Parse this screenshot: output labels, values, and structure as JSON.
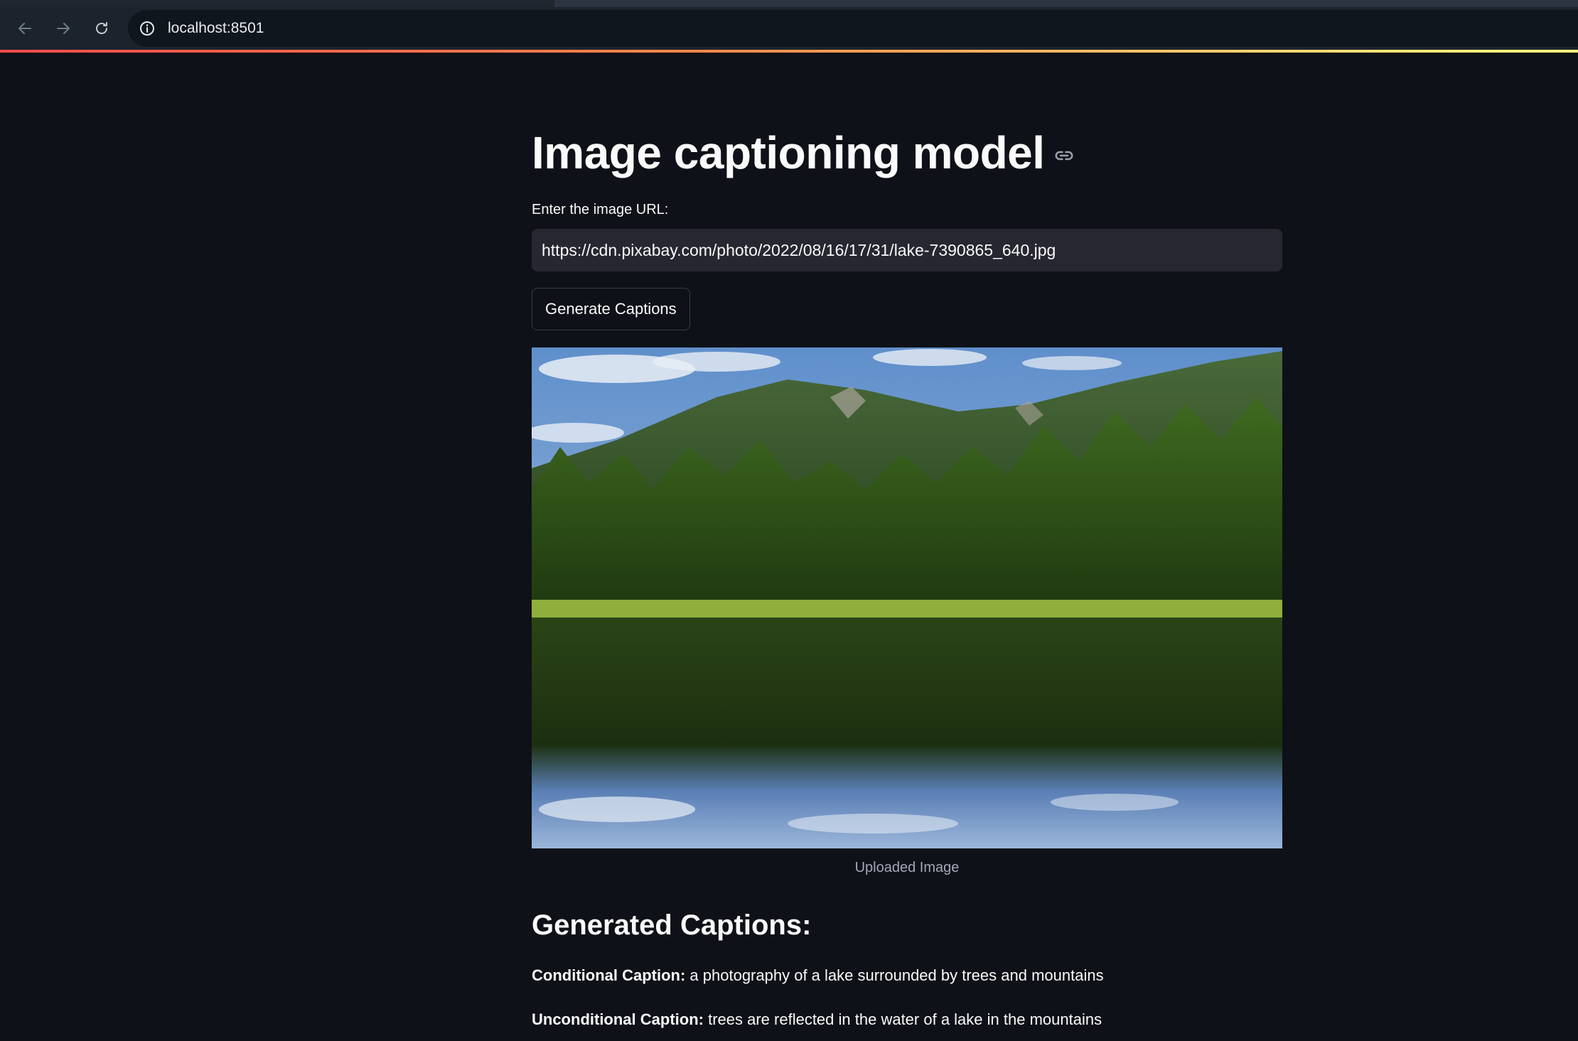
{
  "browser": {
    "url": "localhost:8501",
    "icons": [
      "back-arrow-icon",
      "forward-arrow-icon",
      "reload-icon",
      "site-info-icon"
    ]
  },
  "app": {
    "title": "Image captioning model",
    "url_input": {
      "label": "Enter the image URL:",
      "value": "https://cdn.pixabay.com/photo/2022/08/16/17/31/lake-7390865_640.jpg"
    },
    "generate_button_label": "Generate Captions",
    "image_caption": "Uploaded Image",
    "captions_heading": "Generated Captions:",
    "conditional": {
      "label": "Conditional Caption:",
      "text": "a photography of a lake surrounded by trees and mountains"
    },
    "unconditional": {
      "label": "Unconditional Caption:",
      "text": "trees are reflected in the water of a lake in the mountains"
    }
  },
  "colors": {
    "background": "#0e1117",
    "input_background": "#262730",
    "accent_gradient_start": "#ff4b4b",
    "accent_gradient_end": "#fffd80"
  }
}
